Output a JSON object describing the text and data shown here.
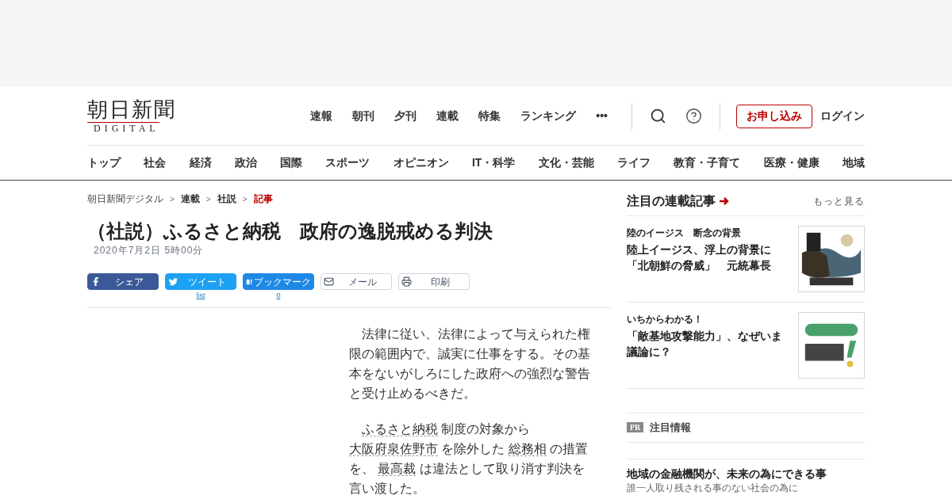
{
  "logo": {
    "name": "朝日新聞",
    "sub": "DIGITAL"
  },
  "top_nav": [
    "速報",
    "朝刊",
    "夕刊",
    "連載",
    "特集",
    "ランキング",
    "•••"
  ],
  "subscribe_button": "お申し込み",
  "login_link": "ログイン",
  "category_nav": [
    "トップ",
    "社会",
    "経済",
    "政治",
    "国際",
    "スポーツ",
    "オピニオン",
    "IT・科学",
    "文化・芸能",
    "ライフ",
    "教育・子育て",
    "医療・健康",
    "地域"
  ],
  "breadcrumb": [
    {
      "label": "朝日新聞デジタル",
      "kind": "plain"
    },
    {
      "label": "連載",
      "kind": "bold"
    },
    {
      "label": "社説",
      "kind": "bold"
    },
    {
      "label": "記事",
      "kind": "current"
    }
  ],
  "breadcrumb_separator": ">",
  "article": {
    "title": "（社説）ふるさと納税　政府の逸脱戒める判決",
    "date": "2020年7月2日 5時00分",
    "share_buttons": [
      {
        "kind": "facebook",
        "label": "シェア"
      },
      {
        "kind": "twitter",
        "label": "ツイート",
        "count": "list"
      },
      {
        "kind": "hatena",
        "label": "ブックマーク",
        "count": "0"
      },
      {
        "kind": "mail",
        "label": "メール"
      },
      {
        "kind": "print",
        "label": "印刷"
      }
    ],
    "paragraphs": [
      [
        {
          "kind": "text",
          "text": "法律に従い、法律によって与えられた権限の範囲内で、誠実に仕事をする。その基本をないがしろにした政府への強烈な警告と受け止めるべきだ。"
        }
      ],
      [
        {
          "kind": "link",
          "text": "ふるさと納税"
        },
        {
          "kind": "text",
          "text": " 制度の対象から "
        },
        {
          "kind": "link",
          "text": "大阪府泉佐野市"
        },
        {
          "kind": "text",
          "text": " を除外した "
        },
        {
          "kind": "link",
          "text": "総務相"
        },
        {
          "kind": "text",
          "text": " の措置を、 "
        },
        {
          "kind": "link",
          "text": "最高裁"
        },
        {
          "kind": "text",
          "text": " は違法として取り消す判決を言い渡した。"
        }
      ]
    ]
  },
  "sidebar": {
    "title": "注目の連載記事",
    "more_link": "もっと見る",
    "items": [
      {
        "series": "陸のイージス　断念の背景",
        "headline": "陸上イージス、浮上の背景に「北朝鮮の脅威」　元統幕長",
        "kind": "picture"
      },
      {
        "series": "いちからわかる！",
        "headline": "「敵基地攻撃能力」、なぜいま議論に？",
        "kind": "picture"
      }
    ],
    "pr": {
      "badge": "PR",
      "title": "注目情報",
      "headline": "地域の金融機関が、未来の為にできる事",
      "snippet": "誰一人取り残される事のない社会の為に"
    }
  }
}
